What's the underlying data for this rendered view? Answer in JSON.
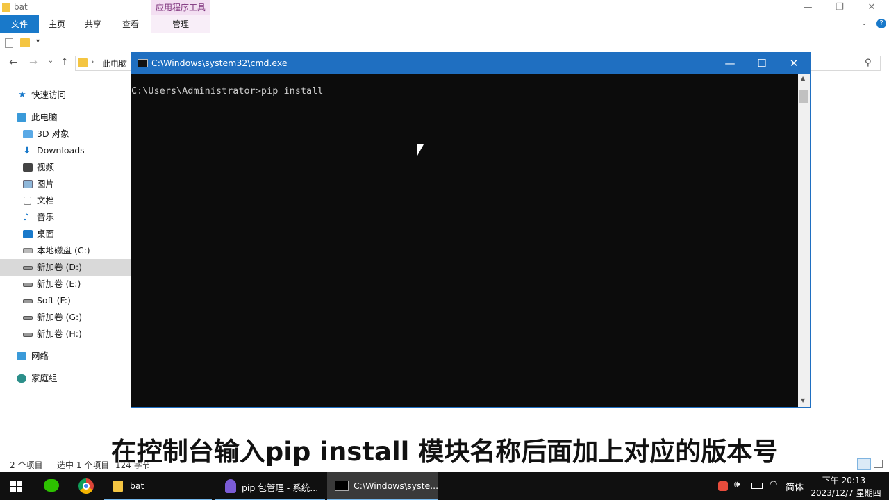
{
  "explorer": {
    "title": "bat",
    "tool_group": "应用程序工具",
    "tabs": [
      "文件",
      "主页",
      "共享",
      "查看",
      "管理"
    ],
    "breadcrumb": "此电脑",
    "sidebar": {
      "quick_access": "快速访问",
      "this_pc": "此电脑",
      "items": [
        "3D 对象",
        "Downloads",
        "视频",
        "图片",
        "文档",
        "音乐",
        "桌面",
        "本地磁盘 (C:)",
        "新加卷 (D:)",
        "新加卷 (E:)",
        "Soft (F:)",
        "新加卷 (G:)",
        "新加卷 (H:)"
      ],
      "network": "网络",
      "homegroup": "家庭组"
    },
    "status": {
      "item_count": "2 个项目",
      "selected": "选中 1 个项目",
      "size": "124 字节"
    }
  },
  "cmd": {
    "title": "C:\\Windows\\system32\\cmd.exe",
    "prompt": "C:\\Users\\Administrator>pip install"
  },
  "caption": "在控制台输入pip install 模块名称后面加上对应的版本号",
  "taskbar": {
    "apps": [
      {
        "label": "bat"
      },
      {
        "label": "pip 包管理 - 系统..."
      },
      {
        "label": "C:\\Windows\\syste..."
      }
    ],
    "ime": "简体",
    "time": "下午 20:13",
    "date": "2023/12/7 星期四"
  },
  "colors": {
    "accent": "#1979ca",
    "cmd_title": "#1f6fc1",
    "taskbar": "#101010"
  }
}
